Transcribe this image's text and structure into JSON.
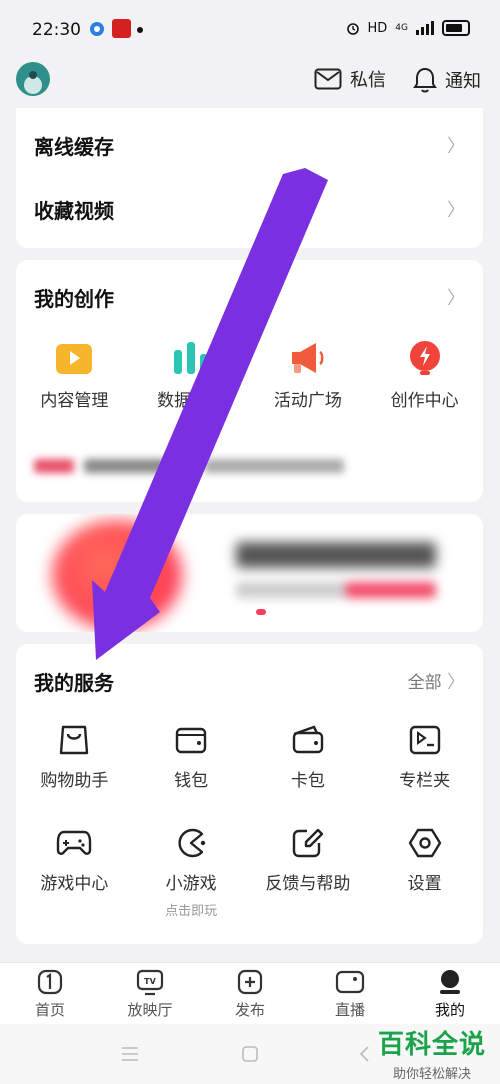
{
  "status": {
    "time": "22:30",
    "hd": "HD",
    "network": "4G"
  },
  "header": {
    "messages_label": "私信",
    "notifications_label": "通知"
  },
  "top_list": {
    "items": [
      {
        "label": "离线缓存"
      },
      {
        "label": "收藏视频"
      }
    ]
  },
  "creation": {
    "title": "我的创作",
    "items": [
      {
        "label": "内容管理",
        "icon": "play-square-icon"
      },
      {
        "label": "数据中心",
        "icon": "bar-chart-icon"
      },
      {
        "label": "活动广场",
        "icon": "megaphone-icon"
      },
      {
        "label": "创作中心",
        "icon": "lightning-bulb-icon"
      }
    ]
  },
  "services": {
    "title": "我的服务",
    "all_label": "全部",
    "items": [
      {
        "label": "购物助手",
        "sub": "",
        "icon": "shopping-bag-icon"
      },
      {
        "label": "钱包",
        "sub": "",
        "icon": "wallet-icon"
      },
      {
        "label": "卡包",
        "sub": "",
        "icon": "card-folder-icon"
      },
      {
        "label": "专栏夹",
        "sub": "",
        "icon": "column-folder-icon"
      },
      {
        "label": "游戏中心",
        "sub": "",
        "icon": "gamepad-icon"
      },
      {
        "label": "小游戏",
        "sub": "点击即玩",
        "icon": "pacman-icon"
      },
      {
        "label": "反馈与帮助",
        "sub": "",
        "icon": "edit-feedback-icon"
      },
      {
        "label": "设置",
        "sub": "",
        "icon": "hexagon-settings-icon"
      }
    ]
  },
  "tabs": [
    {
      "label": "首页",
      "icon": "home-icon"
    },
    {
      "label": "放映厅",
      "icon": "tv-icon"
    },
    {
      "label": "发布",
      "icon": "plus-icon"
    },
    {
      "label": "直播",
      "icon": "camera-icon"
    },
    {
      "label": "我的",
      "icon": "profile-icon"
    }
  ],
  "watermark": {
    "main": "百科全说",
    "sub": "助你轻松解决"
  },
  "colors": {
    "arrow": "#7a2fe0",
    "creation_play": "#f6b52a",
    "creation_chart": "#2cc5b5",
    "creation_megaphone": "#f15a3b",
    "creation_center": "#f0443b",
    "watermark": "#1aa34a"
  }
}
